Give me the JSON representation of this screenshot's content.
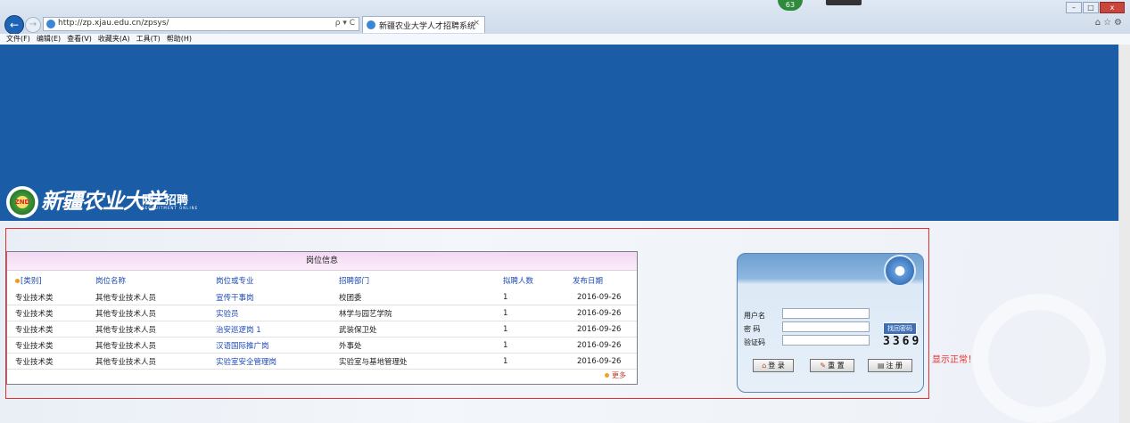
{
  "browser": {
    "url": "http://zp.xjau.edu.cn/zpsys/",
    "address_tools": "ρ ▾ C",
    "tab_title": "新疆农业大学人才招聘系统",
    "tab_close": "×",
    "notification_count": "63",
    "menu": [
      "文件(F)",
      "编辑(E)",
      "查看(V)",
      "收藏夹(A)",
      "工具(T)",
      "帮助(H)"
    ]
  },
  "header": {
    "seal_text": "ZND",
    "school_name": "新疆农业大学",
    "recruit_title": "网上招聘",
    "recruit_subtitle": "RECRUITMENT ONLINE"
  },
  "jobs": {
    "title": "岗位信息",
    "columns": [
      "[类别]",
      "岗位名称",
      "岗位或专业",
      "招聘部门",
      "拟聘人数",
      "发布日期"
    ],
    "rows": [
      [
        "专业技术类",
        "其他专业技术人员",
        "宣传干事岗",
        "校团委",
        "1",
        "2016-09-26"
      ],
      [
        "专业技术类",
        "其他专业技术人员",
        "实验员",
        "林学与园艺学院",
        "1",
        "2016-09-26"
      ],
      [
        "专业技术类",
        "其他专业技术人员",
        "治安巡逻岗 1",
        "武装保卫处",
        "1",
        "2016-09-26"
      ],
      [
        "专业技术类",
        "其他专业技术人员",
        "汉语国际推广岗",
        "外事处",
        "1",
        "2016-09-26"
      ],
      [
        "专业技术类",
        "其他专业技术人员",
        "实验室安全管理岗",
        "实验室与基地管理处",
        "1",
        "2016-09-26"
      ]
    ],
    "more_label": "更多"
  },
  "login": {
    "username_label": "用户名",
    "password_label": "密 码",
    "captcha_label": "验证码",
    "find_password": "找回密码",
    "captcha_value": "3369",
    "login_button": "登 录",
    "reset_button": "重 置",
    "register_button": "注 册"
  },
  "status_text": "显示正常！"
}
